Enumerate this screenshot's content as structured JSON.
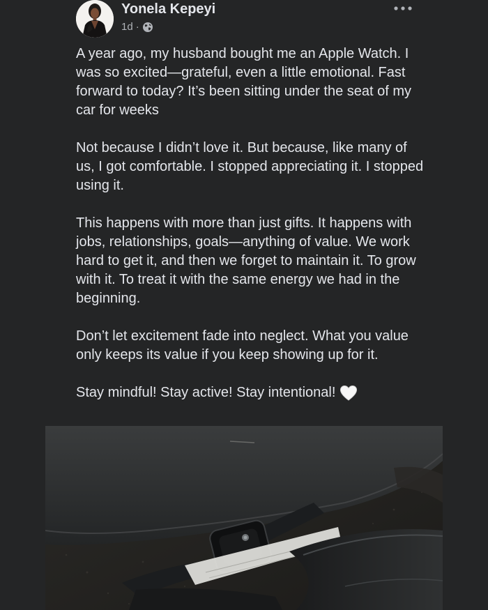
{
  "post": {
    "author": "Yonela Kepeyi",
    "time": "1d",
    "separator": "·",
    "privacy_icon": "globe-icon",
    "more_icon": "more-horizontal-icon",
    "paragraphs": [
      "A year ago, my husband bought me an Apple Watch. I was so excited—grateful, even a little emotional. Fast forward to today? It’s been sitting under the seat of my car for weeks",
      "Not because I didn’t love it. But because, like many of us, I got comfortable. I stopped appreciating it. I stopped using it.",
      "This happens with more than just gifts. It happens with jobs, relationships, goals—anything of value. We work hard to get it, and then we forget to maintain it. To grow with it. To treat it with the same energy we had in the beginning.",
      "Don’t let excitement fade into neglect. What you value only keeps its value if you keep showing up for it."
    ],
    "closing_line": "Stay mindful! Stay active! Stay intentional!",
    "closing_emoji": "white-heart-icon"
  },
  "colors": {
    "background": "#242526",
    "text": "#e4e6eb",
    "secondary_text": "#b0b3b8"
  }
}
